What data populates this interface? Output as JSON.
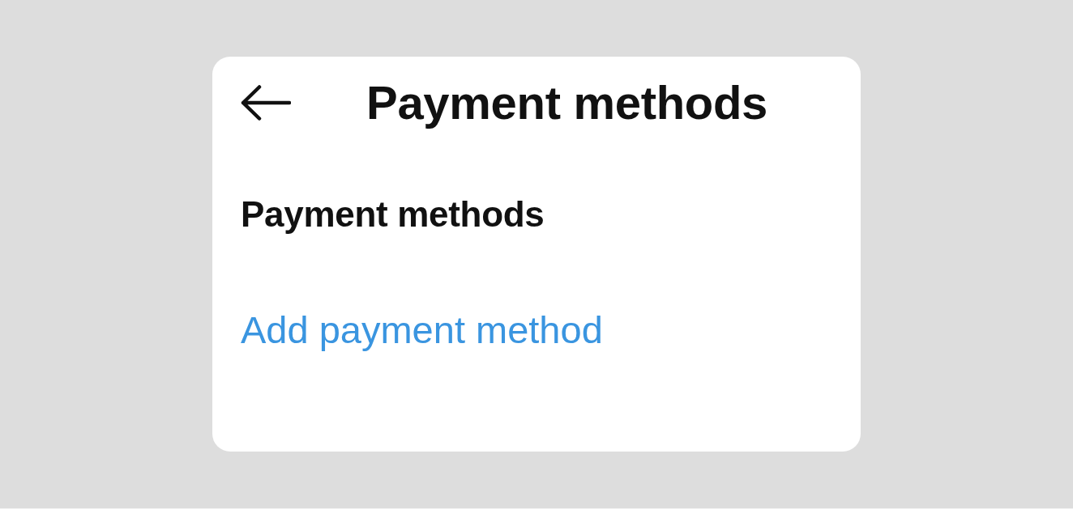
{
  "header": {
    "title": "Payment methods"
  },
  "section": {
    "heading": "Payment methods"
  },
  "add_link": {
    "label": "Add payment method"
  }
}
